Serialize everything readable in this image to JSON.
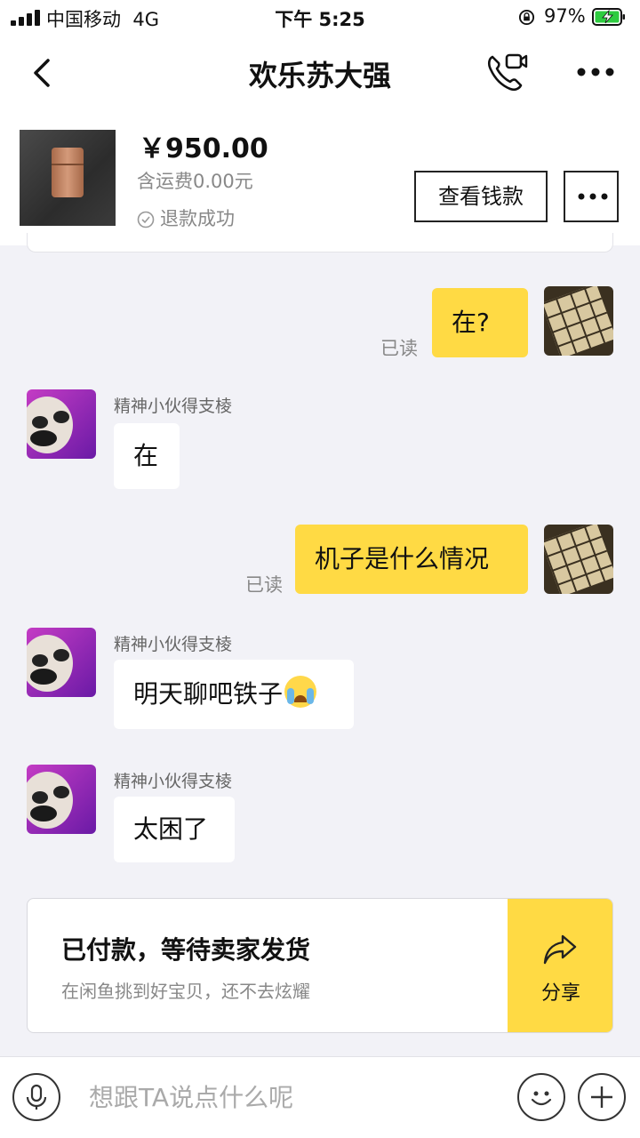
{
  "status_bar": {
    "carrier": "中国移动",
    "network": "4G",
    "time": "下午 5:25",
    "battery": "97%"
  },
  "header": {
    "title": "欢乐苏大强",
    "back_icon": "chevron-left-icon",
    "call_icon": "video-call-icon",
    "more_icon": "more-dots-icon"
  },
  "product": {
    "price": "￥950.00",
    "shipping": "含运费0.00元",
    "status": "退款成功",
    "view_button": "查看钱款"
  },
  "messages": [
    {
      "from": "self",
      "text": "在?",
      "read": "已读"
    },
    {
      "from": "other",
      "sender": "精神小伙得支棱",
      "text": "在"
    },
    {
      "from": "self",
      "text": "机子是什么情况",
      "read": "已读"
    },
    {
      "from": "other",
      "sender": "精神小伙得支棱",
      "text": "明天聊吧铁子"
    },
    {
      "from": "other",
      "sender": "精神小伙得支棱",
      "text": "太困了"
    }
  ],
  "order_status": {
    "title": "已付款，等待卖家发货",
    "subtitle": "在闲鱼挑到好宝贝，还不去炫耀",
    "share_label": "分享"
  },
  "input": {
    "placeholder": "想跟TA说点什么呢"
  },
  "colors": {
    "accent": "#ffda44",
    "background": "#f2f2f7"
  }
}
